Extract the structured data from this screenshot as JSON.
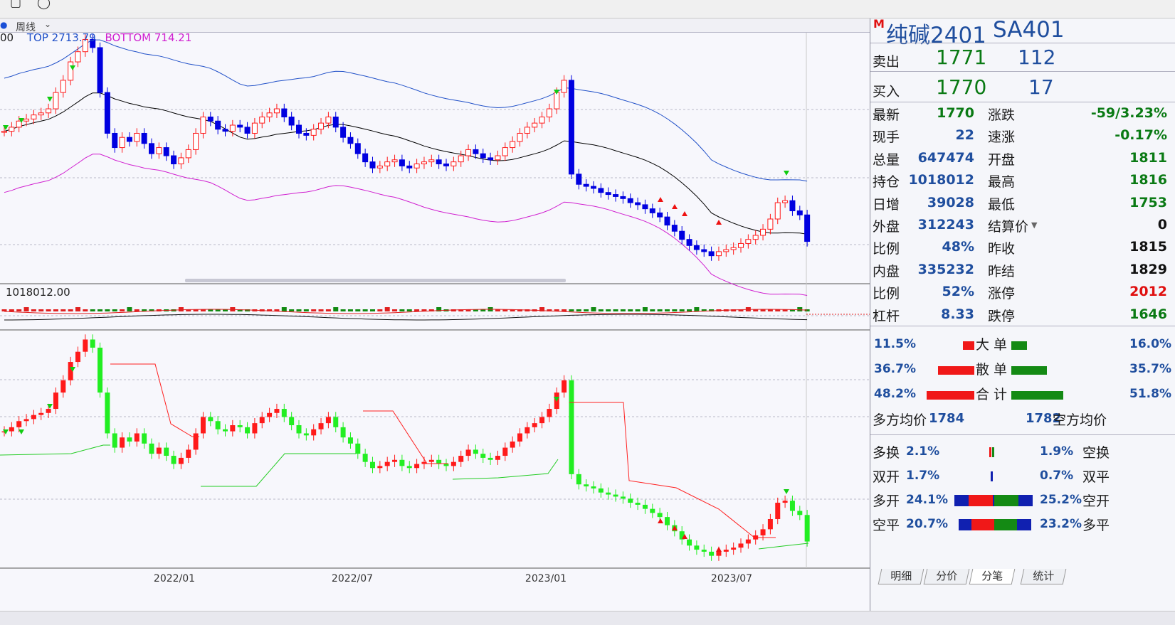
{
  "toolbar": {
    "icons": [
      "box-icon",
      "circle-icon"
    ]
  },
  "period": {
    "label": "周线",
    "arrow": "⌄"
  },
  "main_legend": {
    "prefix": "00",
    "top_label": "TOP 2713.79",
    "bottom_label": "BOTTOM 714.21",
    "top_color": "#2050c8",
    "bottom_color": "#d020d0"
  },
  "volume_legend": "1018012.00",
  "time_axis": [
    "2022/01",
    "2022/07",
    "2023/01",
    "2023/07"
  ],
  "quote": {
    "badge": "M",
    "name": "纯碱2401",
    "code": "SA401",
    "ask_label": "卖出",
    "ask_price": "1771",
    "ask_vol": "112",
    "bid_label": "买入",
    "bid_price": "1770",
    "bid_vol": "17",
    "stats": [
      {
        "l1": "最新",
        "v1": "1770",
        "c1": "g",
        "l2": "涨跌",
        "v2": "-59/3.23%",
        "c2": "g"
      },
      {
        "l1": "现手",
        "v1": "22",
        "c1": "b",
        "l2": "速涨",
        "v2": "-0.17%",
        "c2": "g"
      },
      {
        "l1": "总量",
        "v1": "647474",
        "c1": "b",
        "l2": "开盘",
        "v2": "1811",
        "c2": "g"
      },
      {
        "l1": "持仓",
        "v1": "1018012",
        "c1": "b",
        "l2": "最高",
        "v2": "1816",
        "c2": "g"
      },
      {
        "l1": "日增",
        "v1": "39028",
        "c1": "b",
        "l2": "最低",
        "v2": "1753",
        "c2": "g"
      },
      {
        "l1": "外盘",
        "v1": "312243",
        "c1": "b",
        "l2": "结算价",
        "v2": "0",
        "c2": "k"
      },
      {
        "l1": "比例",
        "v1": "48%",
        "c1": "b",
        "l2": "昨收",
        "v2": "1815",
        "c2": "k"
      },
      {
        "l1": "内盘",
        "v1": "335232",
        "c1": "b",
        "l2": "昨结",
        "v2": "1829",
        "c2": "k"
      },
      {
        "l1": "比例",
        "v1": "52%",
        "c1": "b",
        "l2": "涨停",
        "v2": "2012",
        "c2": "r"
      },
      {
        "l1": "杠杆",
        "v1": "8.33",
        "c1": "b",
        "l2": "跌停",
        "v2": "1646",
        "c2": "g"
      }
    ]
  },
  "order_flow": [
    {
      "left": "11.5%",
      "label": "大 单",
      "right": "16.0%",
      "red": 0.115,
      "green": 0.16
    },
    {
      "left": "36.7%",
      "label": "散 单",
      "right": "35.7%",
      "red": 0.367,
      "green": 0.357
    },
    {
      "left": "48.2%",
      "label": "合 计",
      "right": "51.8%",
      "red": 0.482,
      "green": 0.518
    }
  ],
  "avg_price": {
    "long_label": "多方均价",
    "long_value": "1784",
    "short_value": "1782",
    "short_label": "空方均价"
  },
  "positions": [
    {
      "l_label": "多换",
      "l_val": "2.1%",
      "r_val": "1.9%",
      "r_label": "空换"
    },
    {
      "l_label": "双开",
      "l_val": "1.7%",
      "r_val": "0.7%",
      "r_label": "双平"
    },
    {
      "l_label": "多开",
      "l_val": "24.1%",
      "r_val": "25.2%",
      "r_label": "空开"
    },
    {
      "l_label": "空平",
      "l_val": "20.7%",
      "r_val": "23.2%",
      "r_label": "多平"
    }
  ],
  "tabs": [
    "明细",
    "分价",
    "分笔",
    "统计"
  ],
  "colors": {
    "up": "#ff1a1a",
    "down": "#0000e0",
    "ma": "#000000",
    "green_bar": "#118a11",
    "lower_up": "#ff1a1a",
    "lower_down": "#22ee22"
  },
  "chart_data": {
    "type": "candlestick",
    "period": "weekly",
    "x_labels": [
      "2022/01",
      "2022/07",
      "2023/01",
      "2023/07"
    ],
    "legend": [
      "TOP 2713.79",
      "BOTTOM 714.21"
    ],
    "closes": [
      2310,
      2330,
      2360,
      2370,
      2390,
      2400,
      2420,
      2500,
      2560,
      2650,
      2700,
      2760,
      2720,
      2500,
      2300,
      2230,
      2280,
      2260,
      2300,
      2250,
      2200,
      2230,
      2190,
      2150,
      2180,
      2220,
      2300,
      2380,
      2360,
      2320,
      2310,
      2340,
      2330,
      2300,
      2350,
      2380,
      2400,
      2420,
      2380,
      2340,
      2300,
      2290,
      2320,
      2350,
      2380,
      2330,
      2280,
      2250,
      2200,
      2160,
      2130,
      2140,
      2160,
      2170,
      2140,
      2130,
      2150,
      2160,
      2170,
      2150,
      2140,
      2160,
      2190,
      2220,
      2200,
      2180,
      2170,
      2190,
      2230,
      2260,
      2300,
      2330,
      2350,
      2380,
      2420,
      2500,
      2560,
      2100,
      2050,
      2040,
      2030,
      2010,
      2000,
      1990,
      1980,
      1960,
      1950,
      1930,
      1910,
      1890,
      1850,
      1820,
      1780,
      1750,
      1730,
      1720,
      1700,
      1720,
      1730,
      1740,
      1760,
      1780,
      1800,
      1830,
      1880,
      1960,
      1970,
      1920,
      1900,
      1770
    ],
    "open_interest_last": 1018012
  }
}
